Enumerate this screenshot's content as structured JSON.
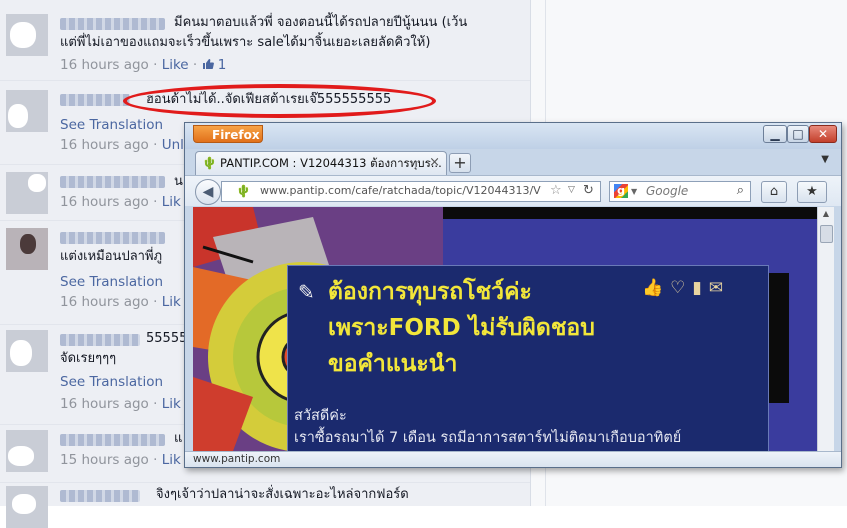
{
  "comments": [
    {
      "text_line1": "มีคนมาตอบแล้วพี่ จองตอนนี้ได้รถปลายปีนู้นนน (เว้น",
      "text_line2": "แต่พี่ไม่เอาของแถมจะเร็วขึ้นเพราะ saleได้มาจิ้นเยอะเลยลัดคิวให้)",
      "time": "16 hours ago",
      "like": "Like",
      "like_count": "1"
    },
    {
      "text": "ฮอนด้าไม่ได้..จัดเฟียสต้าเรยเจ๊555555555",
      "see_translation": "See Translation",
      "time": "16 hours ago",
      "unlike": "Unl"
    },
    {
      "text": "น",
      "time": "16 hours ago",
      "like": "Lik"
    },
    {
      "text": "แต่งเหมือนปลาพี่ภู",
      "see_translation": "See Translation",
      "time": "16 hours ago",
      "like": "Lik"
    },
    {
      "text_line1": "55555",
      "text_line2": "จัดเรยๆๆๆ",
      "see_translation": "See Translation",
      "time": "16 hours ago",
      "like": "Lik"
    },
    {
      "text": "แ",
      "time": "15 hours ago",
      "like": "Lik"
    },
    {
      "text": "จิงๆเจ้าว่าปลาน่าจะสั่งเฉพาะอะไหล่จากฟอร์ด"
    }
  ],
  "browser": {
    "app_button": "Firefox",
    "tab_title": "PANTIP.COM : V12044313 ต้องการทุบร...",
    "tab_close": "×",
    "new_tab": "+",
    "url": "www.pantip.com/cafe/ratchada/topic/V12044313/V1",
    "search_placeholder": "Google",
    "status_url": "www.pantip.com"
  },
  "page": {
    "title_line1": "ต้องการทุบรถโชว์ค่ะ",
    "title_line2": "เพราะFORD ไม่รับผิดชอบ",
    "title_line3": "ขอคำแนะนำ",
    "greeting": "สวัสดีค่ะ",
    "body": "เราซื้อรถมาได้ 7 เดือน รถมีอาการสตาร์ทไม่ติดมาเกือบอาทิตย์"
  },
  "colors": {
    "ellipse": "#e11b1b",
    "link": "#4b67a1",
    "title_yellow": "#f2e63a",
    "panel_bg": "#1b2a6e"
  }
}
